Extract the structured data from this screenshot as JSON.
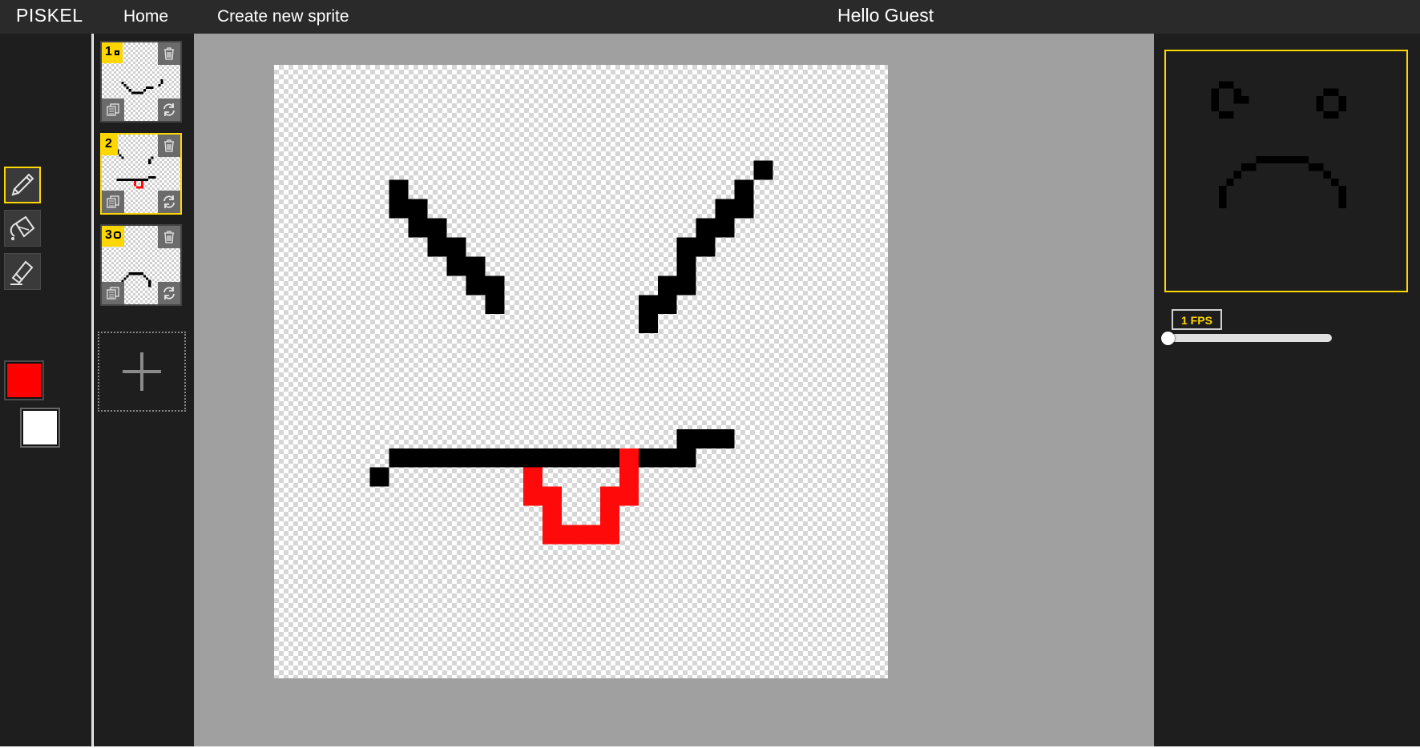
{
  "header": {
    "brand": "PISKEL",
    "nav_home": "Home",
    "nav_create": "Create new sprite",
    "greeting": "Hello Guest"
  },
  "tools": [
    {
      "name": "pen",
      "icon": "pencil-icon",
      "active": true
    },
    {
      "name": "paint-bucket",
      "icon": "paint-bucket-icon",
      "active": false
    },
    {
      "name": "eraser",
      "icon": "eraser-icon",
      "active": false
    }
  ],
  "colors": {
    "primary": "#ff0000",
    "secondary": "#ffffff",
    "accent": "#ffd700",
    "drawing_black": "#000000",
    "drawing_red": "#ff0a0a"
  },
  "frames": [
    {
      "number": "1",
      "selected": false
    },
    {
      "number": "2",
      "selected": true
    },
    {
      "number": "3",
      "selected": false
    }
  ],
  "frame_actions": {
    "delete_icon": "trash-icon",
    "duplicate_icon": "copy-icon",
    "move_icon": "refresh-icon",
    "add_icon": "plus-icon"
  },
  "preview": {
    "fps_label": "1 FPS",
    "fps_value": 1
  }
}
